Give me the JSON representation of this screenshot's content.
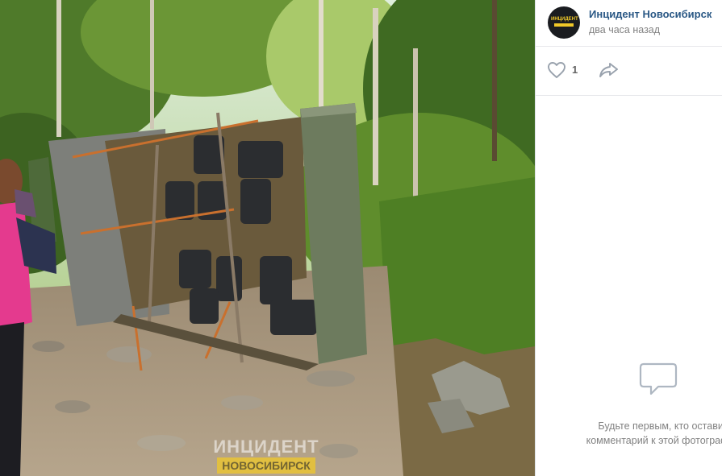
{
  "post": {
    "author_name": "Инцидент Новосибирск",
    "time": "два часа назад",
    "avatar_text": "ИНЦИДЕНТ",
    "likes_count": "1"
  },
  "photo": {
    "watermark_logo": "ИНЦИДЕНТ",
    "watermark_city": "НОВОСИБИРСК"
  },
  "comments": {
    "empty_text_line1": "Будьте первым, кто оставит",
    "empty_text_line2": "комментарий к этой фотографии"
  },
  "icons": {
    "like": "heart-icon",
    "share": "share-arrow-icon",
    "comments_empty": "comment-bubble-icon"
  },
  "colors": {
    "author_link": "#2a5885",
    "secondary_text": "#828282",
    "icon": "#99a2ad"
  }
}
